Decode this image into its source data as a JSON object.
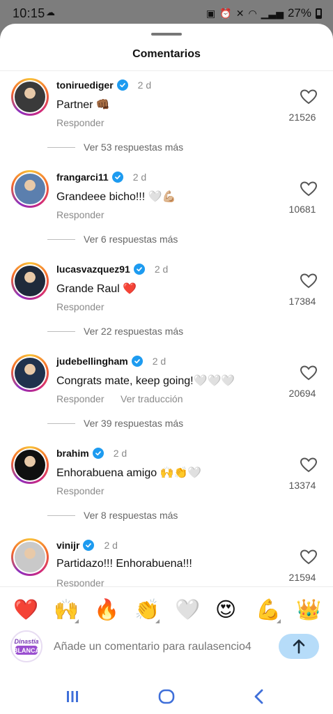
{
  "status_bar": {
    "time": "10:15",
    "battery": "27%",
    "battery_level": 0.27
  },
  "sheet": {
    "title": "Comentarios"
  },
  "comments": [
    {
      "username": "toniruediger",
      "verified": true,
      "time": "2 d",
      "text": "Partner 👊🏾",
      "reply": "Responder",
      "likes": "21526",
      "more": "Ver 53 respuestas más",
      "avatar_color": "#3a3a3a"
    },
    {
      "username": "frangarci11",
      "verified": true,
      "time": "2 d",
      "text": "Grandeee bicho!!! 🤍💪🏼",
      "reply": "Responder",
      "likes": "10681",
      "more": "Ver 6 respuestas más",
      "avatar_color": "#5b7fae"
    },
    {
      "username": "lucasvazquez91",
      "verified": true,
      "time": "2 d",
      "text": "Grande Raul ❤️",
      "reply": "Responder",
      "likes": "17384",
      "more": "Ver 22 respuestas más",
      "avatar_color": "#1f2a3b"
    },
    {
      "username": "judebellingham",
      "verified": true,
      "time": "2 d",
      "text": "Congrats mate, keep going!🤍🤍🤍",
      "reply": "Responder",
      "translate": "Ver traducción",
      "likes": "20694",
      "more": "Ver 39 respuestas más",
      "avatar_color": "#20324d"
    },
    {
      "username": "brahim",
      "verified": true,
      "time": "2 d",
      "text": "Enhorabuena amigo 🙌👏🤍",
      "reply": "Responder",
      "likes": "13374",
      "more": "Ver 8 respuestas más",
      "avatar_color": "#101010"
    },
    {
      "username": "vinijr",
      "verified": true,
      "time": "2 d",
      "text": "Partidazo!!! Enhorabuena!!!",
      "reply": "Responder",
      "likes": "21594",
      "avatar_color": "#c9c9c9"
    }
  ],
  "emoji_bar": [
    "❤️",
    "🙌",
    "🔥",
    "👏",
    "🤍",
    "😍",
    "💪",
    "👑"
  ],
  "input": {
    "placeholder": "Añade un comentario para raulasencio4",
    "avatar_label": "Dinastía BLANCA"
  },
  "colors": {
    "verified": "#1d9bf0",
    "send_bg": "#b6dcf9",
    "send_arrow": "#1b2b3a"
  }
}
